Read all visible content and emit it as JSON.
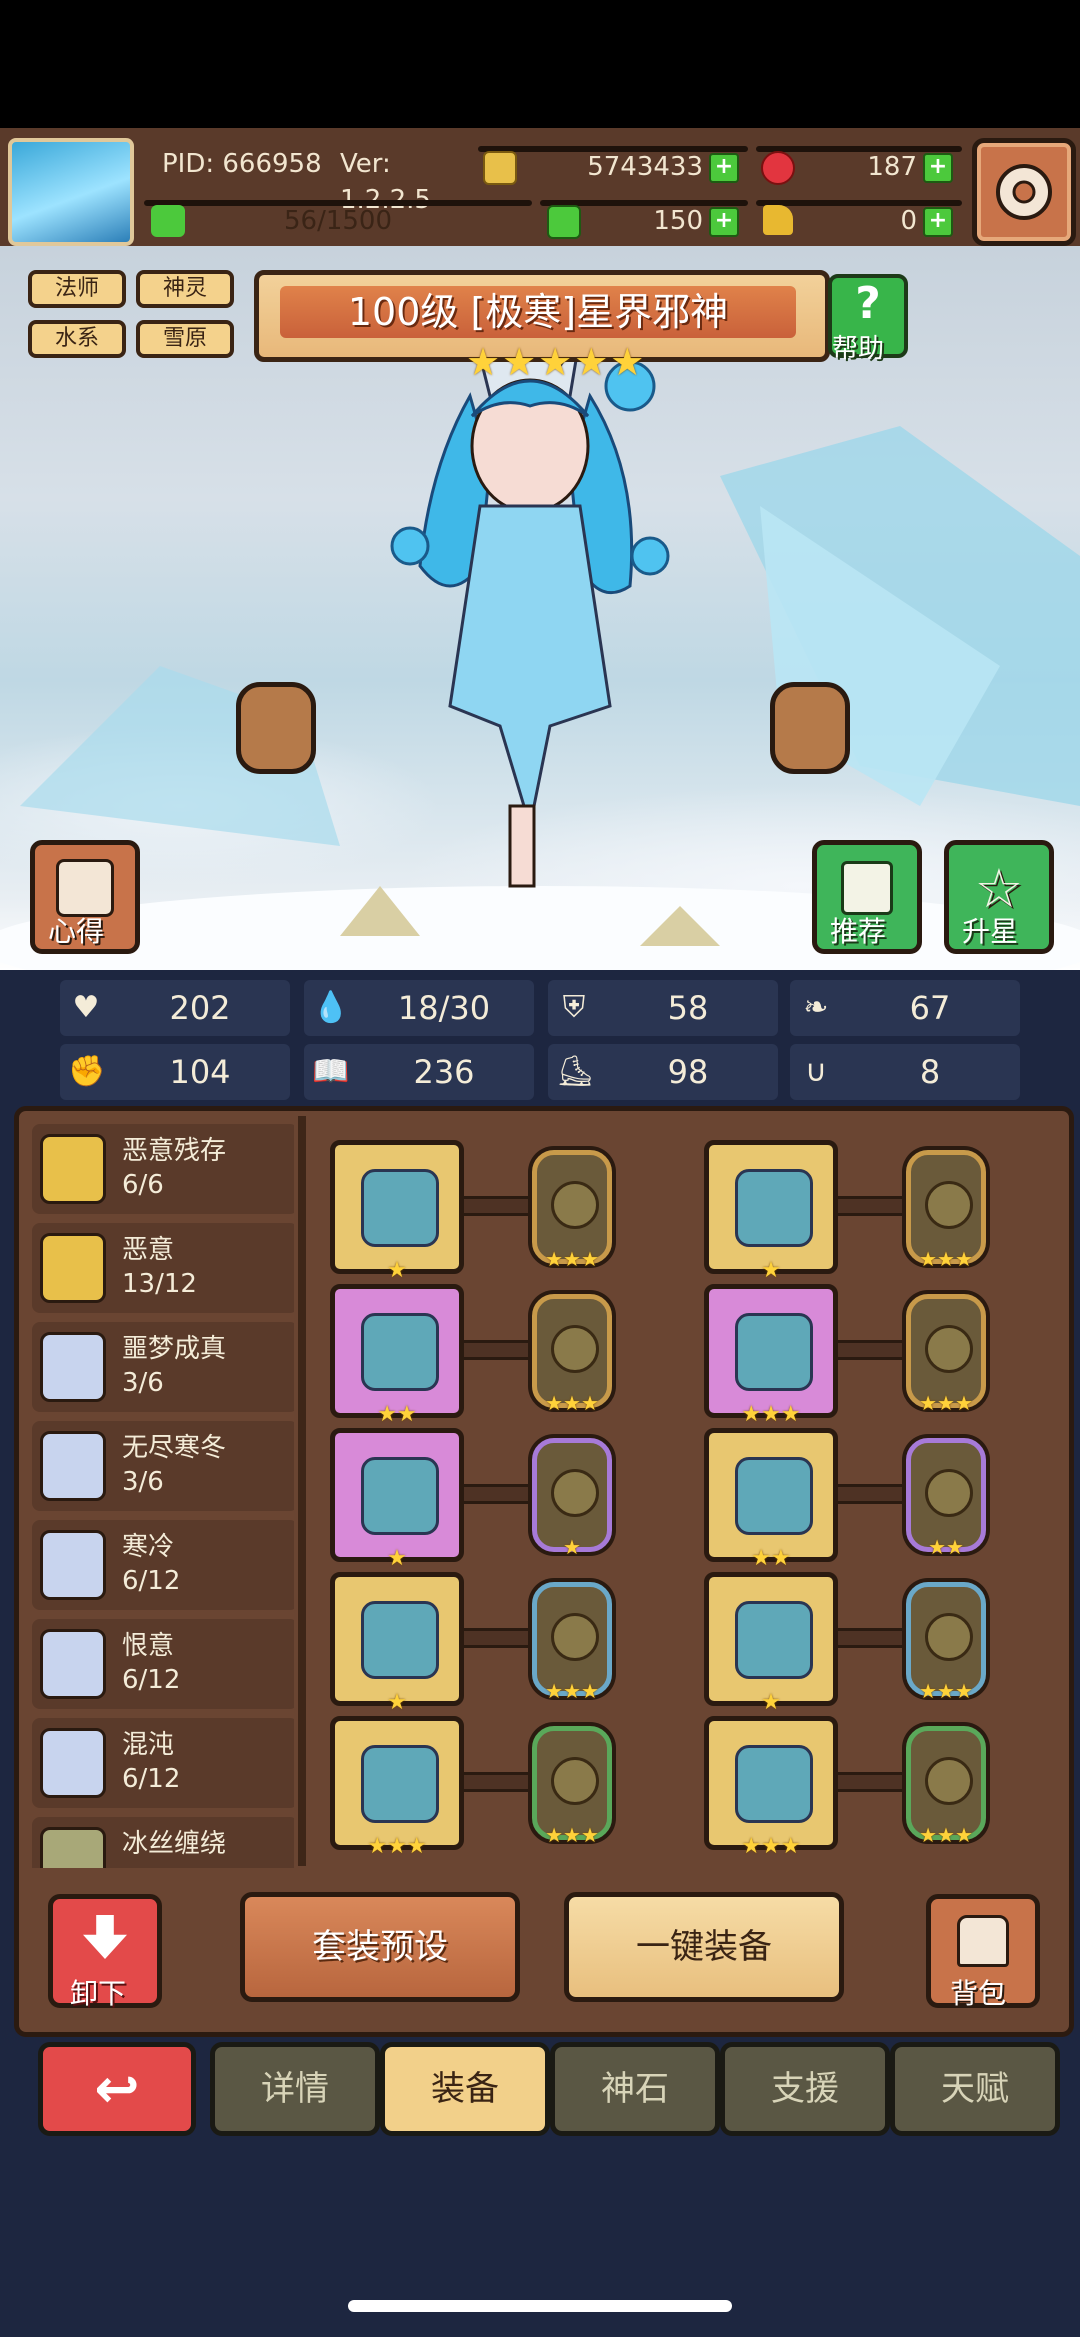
{
  "header": {
    "pid": "PID: 666958",
    "version": "Ver: 1.2.2.5",
    "gold": "5743433",
    "gems": "187",
    "energy": "56/1500",
    "clover": "150",
    "key": "0"
  },
  "tags": [
    "法师",
    "神灵",
    "水系",
    "雪原"
  ],
  "hero": {
    "title": "100级 [极寒]星界邪神",
    "stars": "★★★★★",
    "help_label": "帮助"
  },
  "side_buttons": {
    "insight": "心得",
    "recommend": "推荐",
    "star_up": "升星"
  },
  "stats": [
    {
      "icon": "heart-icon",
      "glyph": "♥",
      "value": "202"
    },
    {
      "icon": "water-drop-icon",
      "glyph": "💧",
      "value": "18/30"
    },
    {
      "icon": "shield-icon",
      "glyph": "⛨",
      "value": "58"
    },
    {
      "icon": "wing-icon",
      "glyph": "❧",
      "value": "67"
    },
    {
      "icon": "fist-icon",
      "glyph": "✊",
      "value": "104"
    },
    {
      "icon": "spellbook-icon",
      "glyph": "📖",
      "value": "236"
    },
    {
      "icon": "boot-icon",
      "glyph": "⛸",
      "value": "98"
    },
    {
      "icon": "horseshoe-icon",
      "glyph": "∪",
      "value": "8"
    }
  ],
  "sets": [
    {
      "name": "恶意残存",
      "count": "6/6",
      "color": "#e8c04a"
    },
    {
      "name": "恶意",
      "count": "13/12",
      "color": "#e8c04a"
    },
    {
      "name": "噩梦成真",
      "count": "3/6",
      "color": "#c8d4ee"
    },
    {
      "name": "无尽寒冬",
      "count": "3/6",
      "color": "#c8d4ee"
    },
    {
      "name": "寒冷",
      "count": "6/12",
      "color": "#c8d4ee"
    },
    {
      "name": "恨意",
      "count": "6/12",
      "color": "#c8d4ee"
    },
    {
      "name": "混沌",
      "count": "6/12",
      "color": "#c8d4ee"
    },
    {
      "name": "冰丝缠绕",
      "count": "",
      "color": "#a8a878"
    }
  ],
  "equipment": [
    {
      "slot": "staff",
      "bg": "#e8c770",
      "stars": "★",
      "rune_stars": "★★★",
      "rune_border": "#c89a4a"
    },
    {
      "slot": "armor",
      "bg": "#e8c770",
      "stars": "★",
      "rune_stars": "★★★",
      "rune_border": "#c89a4a"
    },
    {
      "slot": "crown",
      "bg": "#d88ad8",
      "stars": "★★",
      "rune_stars": "★★★",
      "rune_border": "#c89a4a"
    },
    {
      "slot": "cloak",
      "bg": "#d88ad8",
      "stars": "★★★",
      "rune_stars": "★★★",
      "rune_border": "#c89a4a"
    },
    {
      "slot": "necklace",
      "bg": "#d88ad8",
      "stars": "★",
      "rune_stars": "★",
      "rune_border": "#a77ad8"
    },
    {
      "slot": "gloves",
      "bg": "#e8c770",
      "stars": "★★",
      "rune_stars": "★★",
      "rune_border": "#a77ad8"
    },
    {
      "slot": "stone",
      "bg": "#e8c770",
      "stars": "★",
      "rune_stars": "★★★",
      "rune_border": "#6aa8c8"
    },
    {
      "slot": "mask",
      "bg": "#e8c770",
      "stars": "★",
      "rune_stars": "★★★",
      "rune_border": "#6aa8c8"
    },
    {
      "slot": "ice-helm",
      "bg": "#e8c770",
      "stars": "★★★",
      "rune_stars": "★★★",
      "rune_border": "#5aa85a"
    },
    {
      "slot": "boots",
      "bg": "#e8c770",
      "stars": "★★★",
      "rune_stars": "★★★",
      "rune_border": "#5aa85a"
    }
  ],
  "actions": {
    "unequip": "卸下",
    "preset": "套装预设",
    "auto_equip": "一键装备",
    "backpack": "背包"
  },
  "tabs": [
    "详情",
    "装备",
    "神石",
    "支援",
    "天赋"
  ],
  "active_tab": "装备"
}
